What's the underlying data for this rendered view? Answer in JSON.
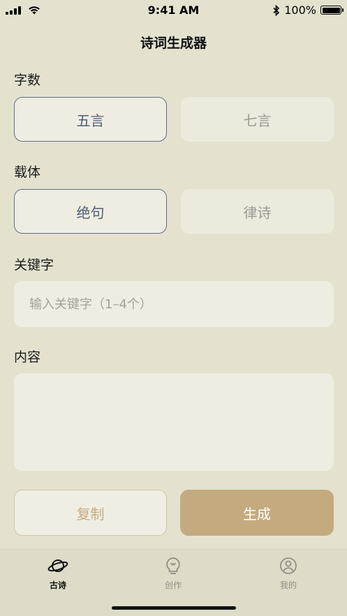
{
  "status_bar": {
    "time": "9:41 AM",
    "battery_text": "100%",
    "battery_level": 1.0
  },
  "nav": {
    "title": "诗词生成器"
  },
  "word_count": {
    "label": "字数",
    "options": [
      {
        "label": "五言",
        "selected": true
      },
      {
        "label": "七言",
        "selected": false
      }
    ]
  },
  "form": {
    "label": "载体",
    "options": [
      {
        "label": "绝句",
        "selected": true
      },
      {
        "label": "律诗",
        "selected": false
      }
    ]
  },
  "keyword": {
    "label": "关键字",
    "placeholder": "输入关键字（1–4个）",
    "value": ""
  },
  "content": {
    "label": "内容",
    "value": ""
  },
  "actions": {
    "copy_label": "复制",
    "generate_label": "生成"
  },
  "tab_bar": {
    "tabs": [
      {
        "label": "古诗",
        "icon": "planet-icon",
        "active": true
      },
      {
        "label": "创作",
        "icon": "lightbulb-icon",
        "active": false
      },
      {
        "label": "我的",
        "icon": "user-icon",
        "active": false
      }
    ]
  },
  "colors": {
    "background": "#e4e2cf",
    "accent": "#c3aa7f",
    "selected_border": "#5f6f86"
  }
}
